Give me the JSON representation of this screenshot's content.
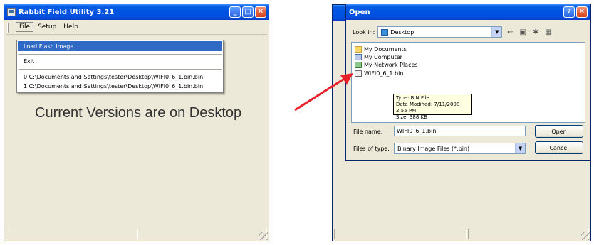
{
  "rabbit_window": {
    "title": "Rabbit Field Utility 3.21",
    "menu": {
      "file": "File",
      "setup": "Setup",
      "help": "Help"
    },
    "file_menu_items": {
      "load_flash_image": "Load Flash Image...",
      "exit": "Exit",
      "recent_0": "0 C:\\Documents and Settings\\tester\\Desktop\\WIFI0_6_1.bin.bin",
      "recent_1": "1 C:\\Documents and Settings\\tester\\Desktop\\WIFI0_6_1.bin.bin"
    }
  },
  "caption": "Current Versions are on Desktop",
  "open_dialog": {
    "title": "Open",
    "look_in_label": "Look in:",
    "look_in_value": "Desktop",
    "files": [
      {
        "name": "My Documents",
        "icon": "folder-icon"
      },
      {
        "name": "My Computer",
        "icon": "computer-icon"
      },
      {
        "name": "My Network Places",
        "icon": "network-icon"
      },
      {
        "name": "WIFI0_6_1.bin",
        "icon": "bin-file-icon"
      }
    ],
    "tooltip": {
      "type": "Type: BIN File",
      "date": "Date Modified: 7/11/2008 2:55 PM",
      "size": "Size: 388 KB"
    },
    "file_name_label": "File name:",
    "file_name_value": "WIFI0_6_1.bin",
    "files_of_type_label": "Files of type:",
    "files_of_type_value": "Binary Image Files (*.bin)",
    "open_button": "Open",
    "cancel_button": "Cancel"
  },
  "colors": {
    "titlebar": "#0054e3",
    "menu_highlight": "#316ac5",
    "pointer_arrow": "#e8202a",
    "tooltip_bg": "#ffffe1"
  }
}
